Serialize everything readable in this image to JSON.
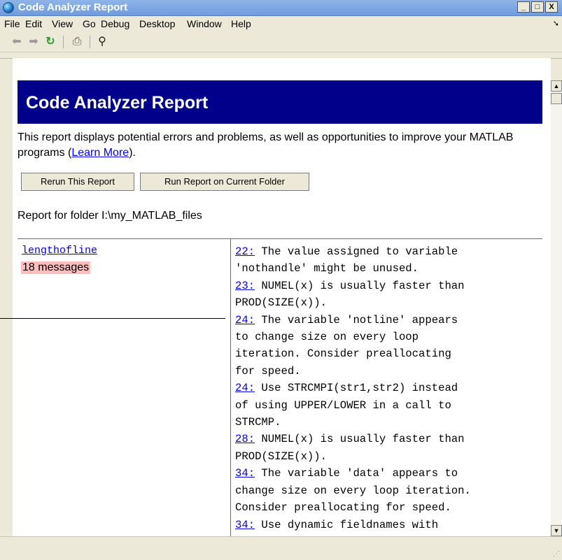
{
  "window": {
    "title": "Code Analyzer Report",
    "controls": {
      "minimize": "_",
      "maximize": "□",
      "close": "X"
    }
  },
  "menubar": {
    "items": [
      "File",
      "Edit",
      "View",
      "Go",
      "Debug",
      "Desktop",
      "Window",
      "Help"
    ],
    "overflow_icon": "arrow-icon"
  },
  "toolbar": {
    "icons": [
      "back-arrow-icon",
      "forward-arrow-icon",
      "refresh-icon",
      "print-icon",
      "find-binoculars-icon"
    ]
  },
  "report": {
    "heading": "Code Analyzer Report",
    "description_prefix": "This report displays potential errors and problems, as well as opportunities to improve your MATLAB programs (",
    "learn_more": "Learn More",
    "description_suffix": ").",
    "rerun_button": "Rerun This Report",
    "run_current_button": "Run Report on Current Folder",
    "folder_line": "Report for folder I:\\my_MATLAB_files"
  },
  "results": {
    "file_name": "lengthofline",
    "message_count": "18 messages",
    "messages": [
      {
        "line": "22:",
        "text": " The value assigned to variable\n'nothandle' might be unused."
      },
      {
        "line": "23:",
        "text": " NUMEL(x) is usually faster than\nPROD(SIZE(x))."
      },
      {
        "line": "24:",
        "text": " The variable 'notline' appears\nto change size on every loop\niteration. Consider preallocating\nfor speed."
      },
      {
        "line": "24:",
        "text": " Use STRCMPI(str1,str2) instead\nof using UPPER/LOWER in a call to\nSTRCMP."
      },
      {
        "line": "28:",
        "text": " NUMEL(x) is usually faster than\nPROD(SIZE(x))."
      },
      {
        "line": "34:",
        "text": " The variable 'data' appears to\nchange size on every loop iteration.\nConsider preallocating for speed."
      },
      {
        "line": "34:",
        "text": " Use dynamic fieldnames with\nstructures instead of GETFIELD."
      }
    ]
  },
  "colors": {
    "header_band": "#00008b",
    "link": "#0000ee",
    "count_highlight": "#ffbdbd"
  }
}
